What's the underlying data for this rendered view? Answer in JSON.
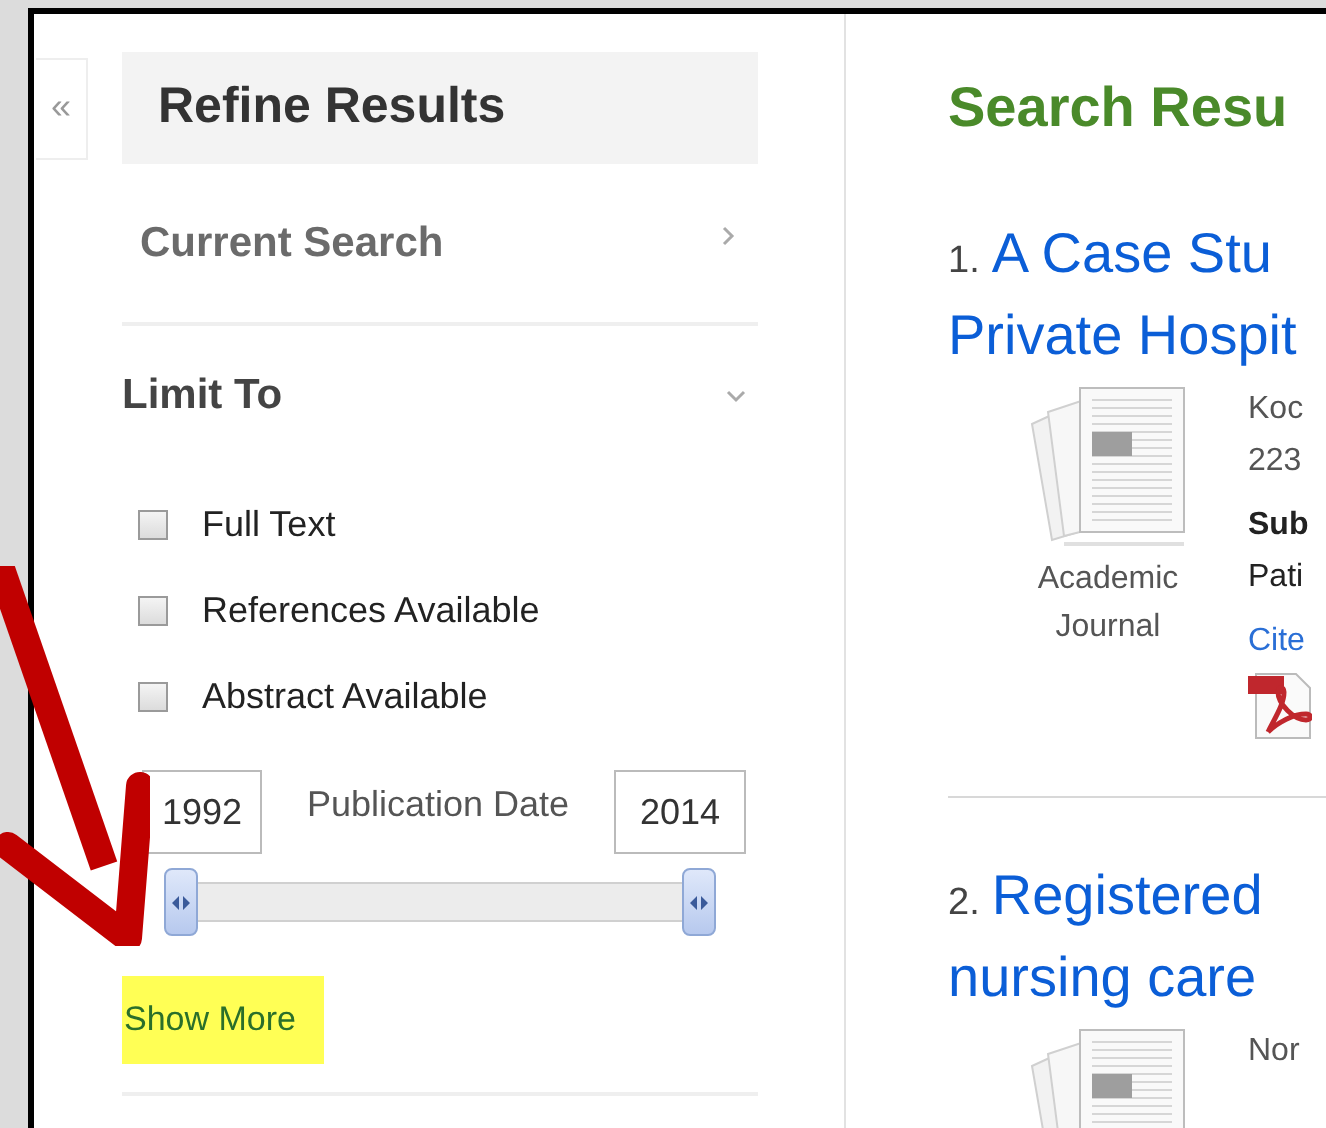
{
  "collapse_button": {
    "label": "«"
  },
  "sidebar": {
    "title": "Refine Results",
    "sections": [
      {
        "kind": "link",
        "title": "Current Search",
        "expanded": false
      },
      {
        "kind": "limits",
        "title": "Limit To",
        "expanded": true
      }
    ],
    "limits": [
      {
        "label": "Full Text",
        "checked": false
      },
      {
        "label": "References Available",
        "checked": false
      },
      {
        "label": "Abstract Available",
        "checked": false
      }
    ],
    "date_range": {
      "from": "1992",
      "label": "Publication Date",
      "to": "2014",
      "low": {
        "level": 0
      },
      "high": {
        "level": 1
      }
    },
    "show_more": {
      "label": "Show More",
      "highlighted": true
    }
  },
  "results": {
    "heading": "Search Resu",
    "items": [
      {
        "number": "1.",
        "title_lines": [
          "A Case Stu",
          "Private Hospit"
        ],
        "type_label": [
          "Academic",
          "Journal"
        ],
        "meta": [
          "Koc",
          "223"
        ],
        "subject_label": "Sub",
        "subject": "Pati",
        "cite": "Cite",
        "pdf": true
      },
      {
        "number": "2.",
        "title_lines": [
          "Registered",
          "nursing care"
        ],
        "meta": [
          "Nor"
        ],
        "pdf": false
      }
    ]
  }
}
